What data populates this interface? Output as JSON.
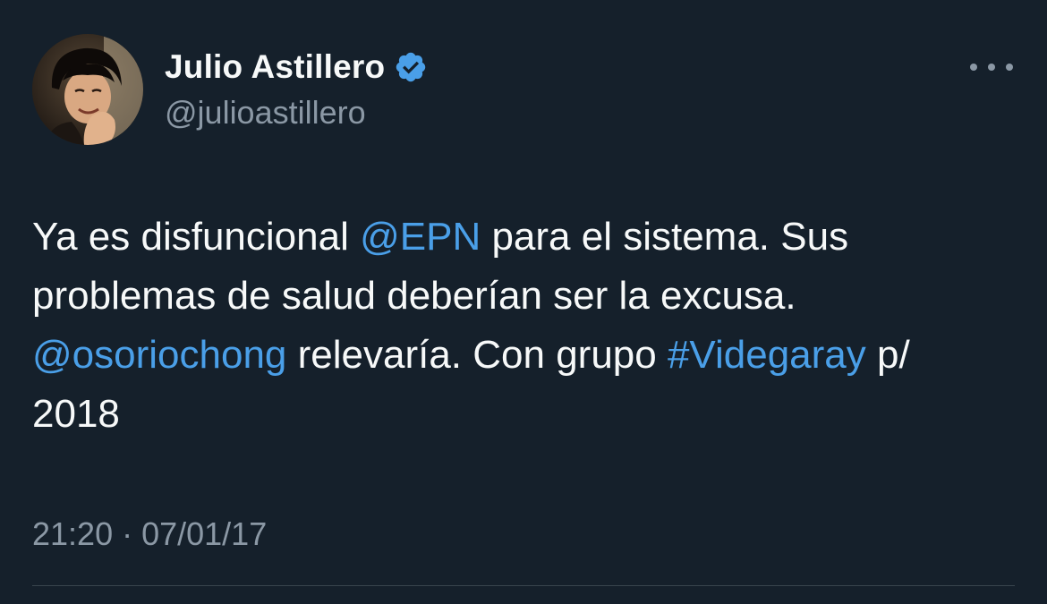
{
  "author": {
    "display_name": "Julio Astillero",
    "handle": "@julioastillero",
    "verified": true
  },
  "tweet": {
    "text_segments": [
      {
        "text": "Ya es disfuncional ",
        "type": "text"
      },
      {
        "text": "@EPN",
        "type": "mention"
      },
      {
        "text": " para el sistema. Sus problemas de salud deberían ser la excusa. ",
        "type": "text"
      },
      {
        "text": "@osoriochong",
        "type": "mention"
      },
      {
        "text": " relevaría. Con grupo ",
        "type": "text"
      },
      {
        "text": "#Videgaray",
        "type": "hashtag"
      },
      {
        "text": " p/ 2018",
        "type": "text"
      }
    ],
    "timestamp": "21:20 · 07/01/17"
  },
  "icons": {
    "verified": "verified-badge-icon",
    "more": "more-options-icon"
  },
  "colors": {
    "background": "#15202b",
    "text_primary": "#f7f9f9",
    "text_secondary": "#8b98a5",
    "link": "#4a9fe8",
    "verified": "#4a9fe8",
    "divider": "#38444d"
  }
}
